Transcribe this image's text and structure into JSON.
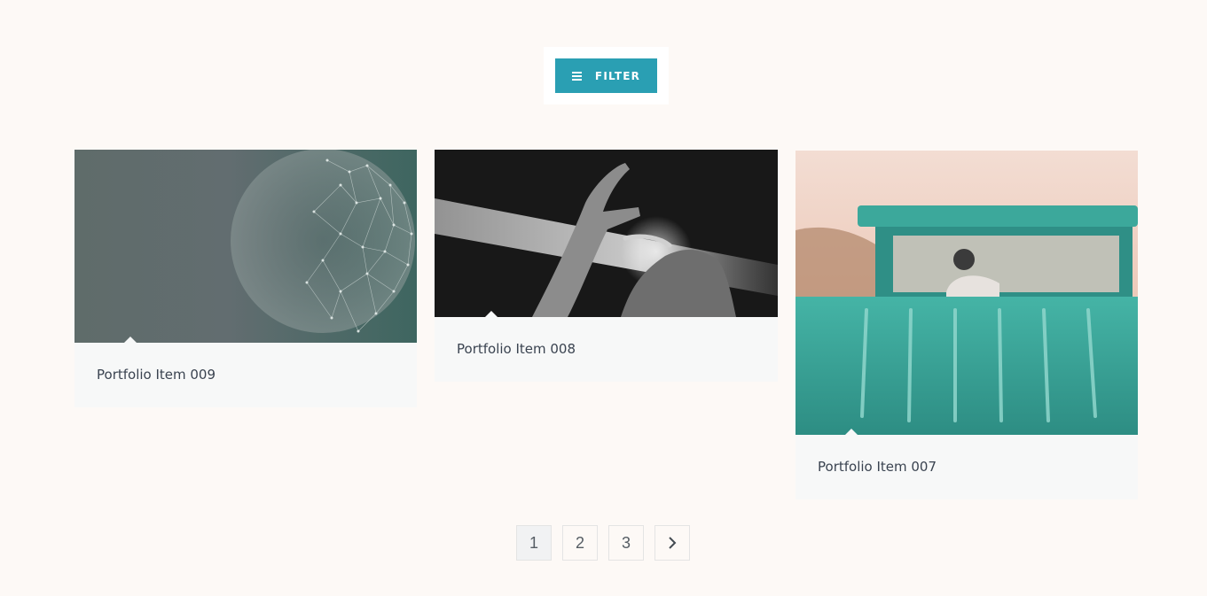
{
  "filter": {
    "label": "Filter",
    "icon": "menu-icon",
    "color": "#2a9fb3"
  },
  "portfolio": {
    "items": [
      {
        "title": "Portfolio Item 009",
        "image": "globe-network-image"
      },
      {
        "title": "Portfolio Item 008",
        "image": "hands-light-image"
      },
      {
        "title": "Portfolio Item 007",
        "image": "teal-car-image"
      }
    ]
  },
  "pagination": {
    "pages": [
      "1",
      "2",
      "3"
    ],
    "current": "1",
    "next_icon": "chevron-right-icon"
  }
}
